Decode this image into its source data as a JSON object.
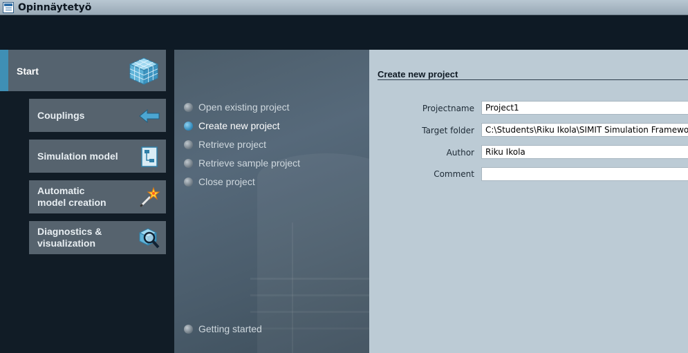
{
  "window": {
    "title": "Opinnäytetyö"
  },
  "nav": {
    "start_label": "Start",
    "buttons": [
      {
        "label": "Couplings",
        "icon": "arrow-left-icon"
      },
      {
        "label": "Simulation model",
        "icon": "diagram-icon"
      },
      {
        "label": "Automatic\nmodel creation",
        "icon": "magic-wand-icon"
      },
      {
        "label": "Diagnostics &\nvisualization",
        "icon": "magnifier-cube-icon"
      }
    ]
  },
  "menu": {
    "items": [
      {
        "label": "Open existing project",
        "active": false
      },
      {
        "label": "Create new project",
        "active": true
      },
      {
        "label": "Retrieve project",
        "active": false
      },
      {
        "label": "Retrieve sample project",
        "active": false
      },
      {
        "label": "Close project",
        "active": false
      }
    ],
    "getting_started": "Getting started"
  },
  "form": {
    "title": "Create new project",
    "fields": [
      {
        "label": "Projectname",
        "value": "Project1"
      },
      {
        "label": "Target folder",
        "value": "C:\\Students\\Riku Ikola\\SIMIT Simulation Framework"
      },
      {
        "label": "Author",
        "value": "Riku Ikola"
      },
      {
        "label": "Comment",
        "value": ""
      }
    ]
  },
  "colors": {
    "accent": "#3f8fb5",
    "form_bg": "#bccbd5",
    "nav_button": "#56636e"
  }
}
